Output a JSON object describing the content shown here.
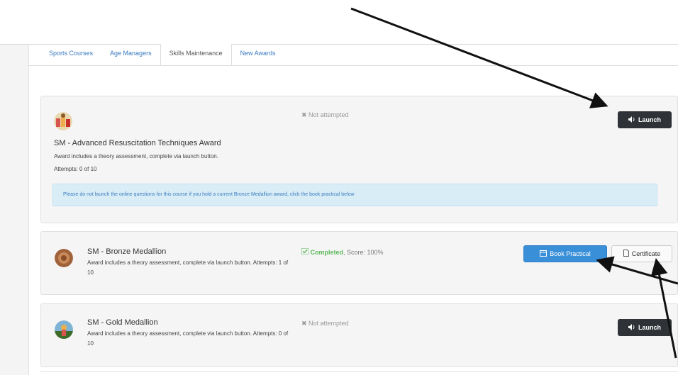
{
  "tabs": [
    {
      "label": "Sports Courses",
      "active": false
    },
    {
      "label": "Age Managers",
      "active": false
    },
    {
      "label": "Skills Maintenance",
      "active": true
    },
    {
      "label": "New Awards",
      "active": false
    }
  ],
  "courses": [
    {
      "title": "SM - Advanced Resuscitation Techniques Award",
      "description": "Award includes a theory assessment, complete via launch button.",
      "attempts": "Attempts: 0 of 10",
      "status": "✖ Not attempted",
      "launch_label": "Launch",
      "alert": "Please do not launch the online questions for this course if you hold a current Bronze Medallion award, click the book practical below"
    },
    {
      "title": "SM - Bronze Medallion",
      "description": "Award includes a theory assessment, complete via launch button. Attempts: 1 of 10",
      "status": "Completed",
      "score": ", Score: 100%",
      "book_label": "Book Practical",
      "certificate_label": "Certificate"
    },
    {
      "title": "SM - Gold Medallion",
      "description": "Award includes a theory assessment, complete via launch button. Attempts: 0 of 10",
      "status": "✖ Not attempted",
      "launch_label": "Launch"
    }
  ],
  "colors": {
    "link": "#3a7bbf",
    "success": "#5cb85c",
    "primary": "#3a8fd9",
    "dark_button": "#2f3337",
    "alert_bg": "#d9edf7"
  },
  "icons": [
    "volume-icon",
    "calendar-icon",
    "document-icon",
    "check-icon",
    "cross-icon"
  ]
}
